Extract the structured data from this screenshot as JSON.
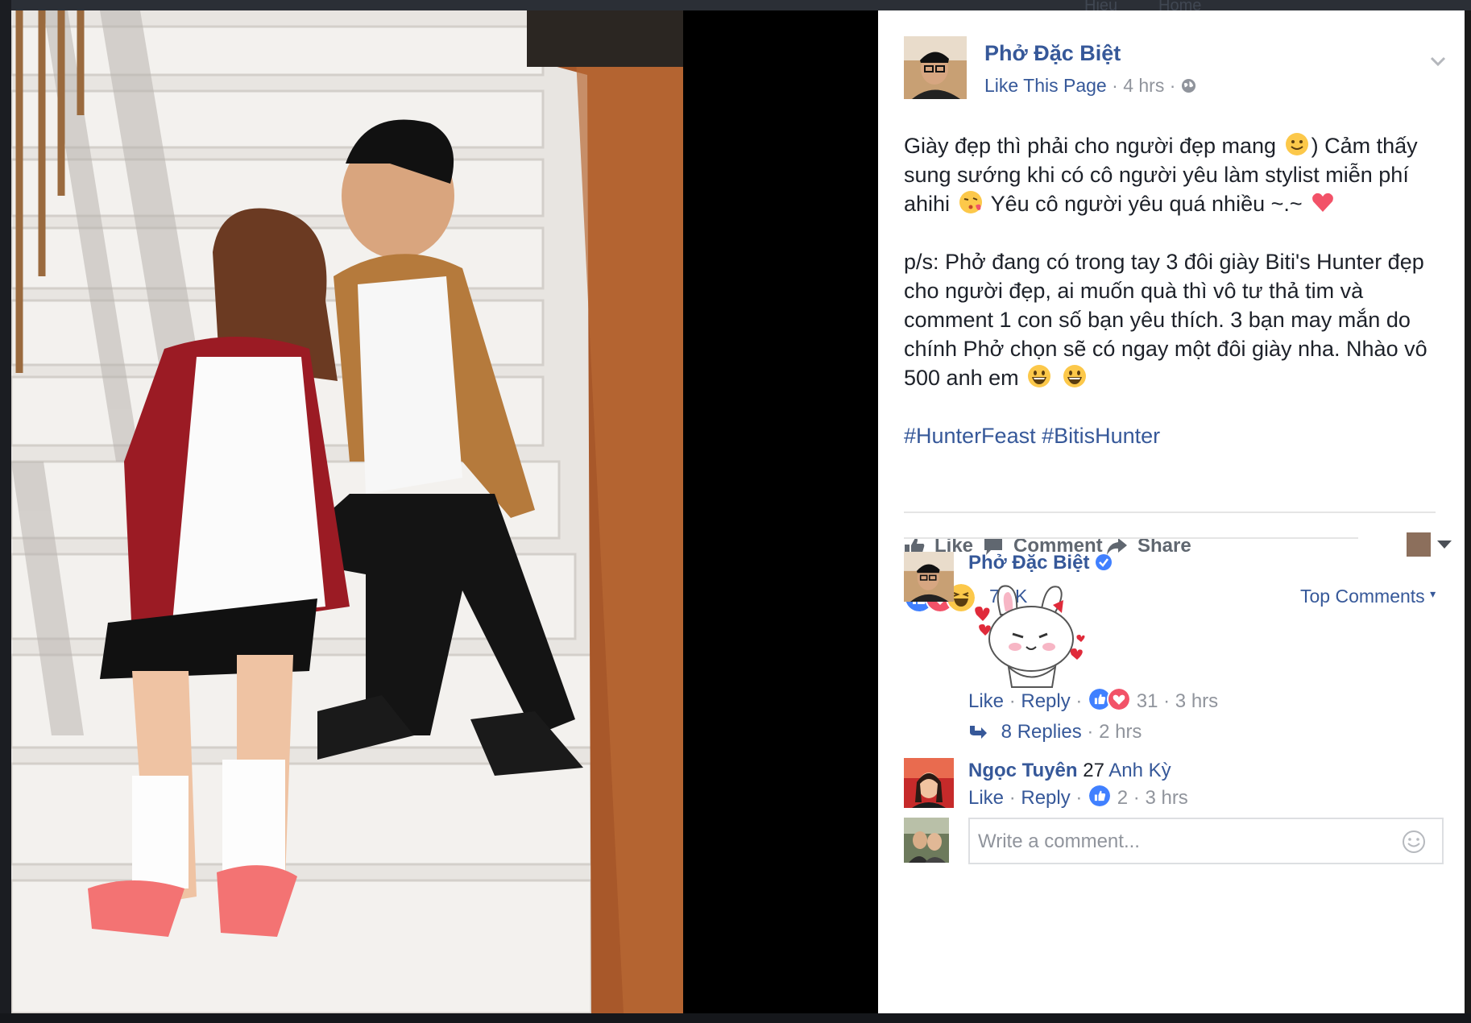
{
  "background": {
    "ghost_texts": [
      "Hieu",
      "Home"
    ]
  },
  "post": {
    "page_name": "Phở Đặc Biệt",
    "like_page_label": "Like This Page",
    "meta_separator": "·",
    "time": "4 hrs",
    "para1_a": "Giày đẹp thì phải cho người đẹp mang",
    "para1_b": ") Cảm thấy sung sướng khi có cô người yêu làm stylist miễn phí ahihi",
    "para1_c": "Yêu cô người yêu quá nhiều ~.~",
    "para2": "p/s: Phở đang có trong tay 3 đôi giày Biti's Hunter đẹp cho người đẹp, ai muốn quà thì vô tư thả tim và comment 1 con số bạn yêu thích. 3 bạn may mắn do chính Phở chọn sẽ có ngay một đôi giày nha. Nhào vô 500 anh em",
    "hashtags": "#HunterFeast #BitisHunter"
  },
  "actions": {
    "like": "Like",
    "comment": "Comment",
    "share": "Share"
  },
  "reactions": {
    "count": "7.8K",
    "sort_label": "Top Comments",
    "sort_caret": "▾"
  },
  "comments": [
    {
      "name": "Phở Đặc Biệt",
      "verified": true,
      "like": "Like",
      "reply": "Reply",
      "reaction_count": "31",
      "time": "3 hrs",
      "replies_label": "8 Replies",
      "replies_time": "2 hrs"
    },
    {
      "name": "Ngọc Tuyên",
      "text": "27",
      "mention": "Anh Kỳ",
      "like": "Like",
      "reply": "Reply",
      "reaction_count": "2",
      "time": "3 hrs"
    }
  ],
  "composer": {
    "placeholder": "Write a comment..."
  },
  "colors": {
    "link": "#365899",
    "muted": "#90949c",
    "text": "#1d2129",
    "like_blue": "#4080ff",
    "love_red": "#f25268",
    "haha_yellow": "#fcc84a"
  },
  "icons": [
    "globe-icon",
    "chevron-down-icon",
    "thumbs-up-icon",
    "comment-icon",
    "share-icon",
    "like-reaction-icon",
    "love-reaction-icon",
    "haha-reaction-icon",
    "verified-badge-icon",
    "reply-arrow-icon",
    "smiley-icon",
    "bunny-sticker"
  ]
}
